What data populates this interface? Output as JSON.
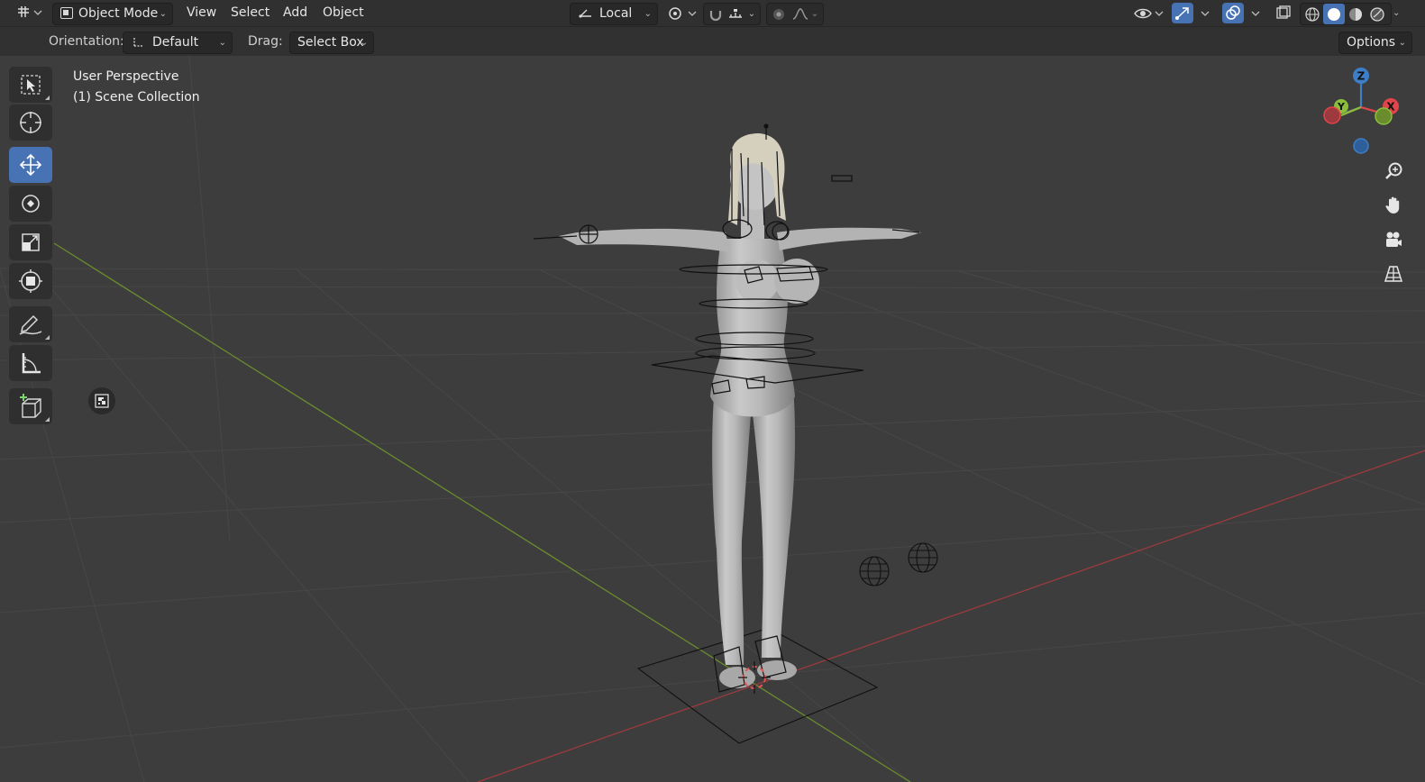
{
  "header": {
    "mode_label": "Object Mode",
    "menus": [
      "View",
      "Select",
      "Add",
      "Object"
    ],
    "transform_orientation": "Local",
    "options_label": "Options"
  },
  "tool_settings": {
    "orientation_label": "Orientation:",
    "orientation_value": "Default",
    "drag_label": "Drag:",
    "drag_value": "Select Box"
  },
  "viewport": {
    "view_name": "User Perspective",
    "collection_name": "(1) Scene Collection"
  },
  "gizmo": {
    "axes": [
      "X",
      "Y",
      "Z"
    ],
    "colors": {
      "x": "#e2444b",
      "y": "#8bbf3b",
      "z": "#3d7ec7"
    }
  },
  "toolbar": {
    "tools": [
      "select-box",
      "cursor",
      "move",
      "rotate",
      "scale",
      "transform",
      "annotate",
      "measure",
      "add-cube"
    ],
    "active_tool": "move"
  },
  "colors": {
    "accent": "#4772b3",
    "grid_x_axis": "#9c3a3f",
    "grid_y_axis": "#6b8c2d"
  }
}
